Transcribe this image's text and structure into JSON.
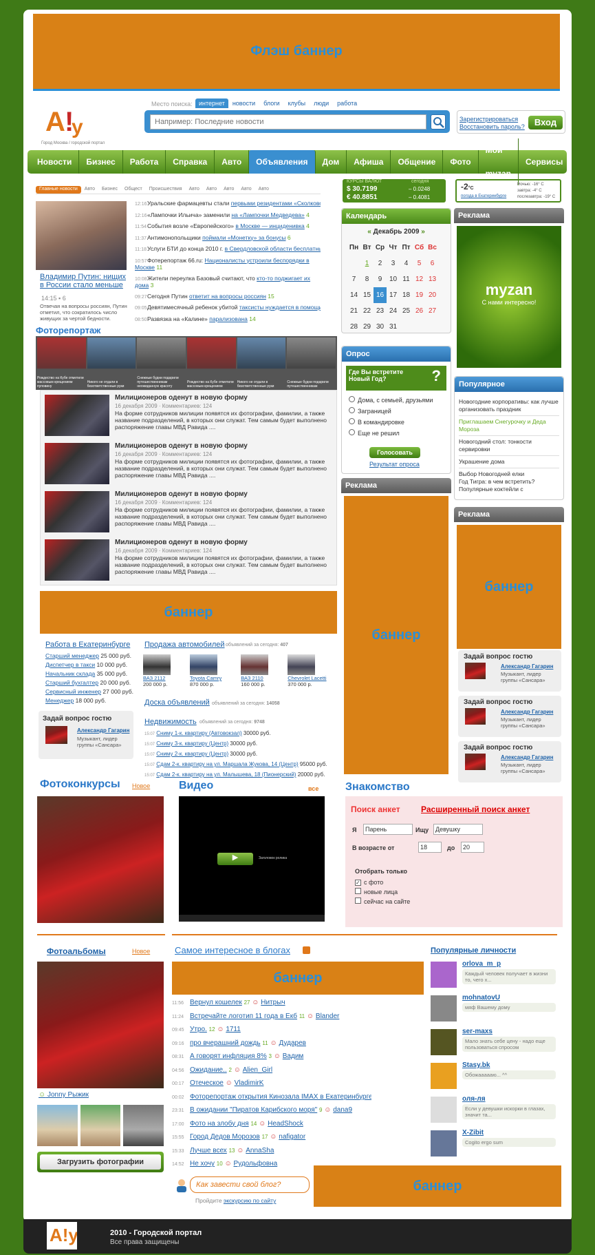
{
  "banners": {
    "flash": "Флэш баннер",
    "generic": "баннер"
  },
  "search": {
    "place_label": "Место поиска:",
    "tabs": [
      "интернет",
      "новости",
      "блоги",
      "клубы",
      "люди",
      "работа"
    ],
    "placeholder": "Например: Последние новости",
    "register": "Зарегистрироваться",
    "restore": "Восстановить пароль?",
    "login": "Вход"
  },
  "logo": {
    "caption": "Город Москва / городской портал"
  },
  "nav": [
    "Новости",
    "Бизнес",
    "Работа",
    "Справка",
    "Авто",
    "Объявления",
    "Дом",
    "Афиша",
    "Общение",
    "Фото",
    "Мой myzan",
    "Сервисы"
  ],
  "news": {
    "tabs": [
      "Главные новости",
      "Авто",
      "Бизнес",
      "Общест",
      "Происшествия",
      "Авто",
      "Авто",
      "Авто",
      "Авто",
      "Авто"
    ],
    "lead_title": "Владимир Путин: нищих в России стало меньше",
    "lead_time": "14:15",
    "lead_count": "6",
    "lead_text": "Отвечая на вопросы россиян, Путин отметил, что сократилось число живущих за чертой бедности.",
    "items": [
      {
        "time": "12:16",
        "pre": "Уральские фармацевты стали ",
        "link": "первыми резидентами «Сколково»",
        "count": "1"
      },
      {
        "time": "12:16",
        "pre": "«Лампочки Ильича» заменили ",
        "link": "на «Лампочки Медведева»",
        "count": "4"
      },
      {
        "time": "11:54",
        "pre": "События возле «Европейского» ",
        "link": "в Москве — инциденивка",
        "count": "4"
      },
      {
        "time": "11:37",
        "pre": "Антимонопольщики ",
        "link": "поймали «Монетку» за бонусы",
        "count": "6"
      },
      {
        "time": "11:18",
        "pre": "Услуги БТИ до конца 2010 г. ",
        "link": "в Свердловской области бесплатны",
        "count": "1"
      },
      {
        "time": "10:57",
        "pre": "Фотерепортаж 66.ru: ",
        "link": "Националисты устроили беспорядки в Москве",
        "count": "11"
      },
      {
        "time": "10:08",
        "pre": "Жители переулка Базовый считают, что ",
        "link": "кто-то поджигает их дома",
        "count": "3"
      },
      {
        "time": "09:27",
        "pre": "Сегодня Путин ",
        "link": "ответит на вопросы россиян",
        "count": "15"
      },
      {
        "time": "09:05",
        "pre": "Девятимесячный ребенок убитой ",
        "link": "таксисты нуждается в помощи",
        "count": "8"
      },
      {
        "time": "08:50",
        "pre": "Развязка на «Калине» ",
        "link": "парализована",
        "count": "14"
      }
    ]
  },
  "photoreport": {
    "title": "Фоторепортаж",
    "captions": [
      "Рождество на Кубе отметили массовым крещением пуповину",
      "Никого не отдали в безответственные руки",
      "Снежные будни подарили путешественникам неожиданную красоту",
      "Рождество на Кубе отметили массовым крещением",
      "Никого не отдали в безответственные руки",
      "Снежные будни подарили путешественникам"
    ]
  },
  "articles": [
    {
      "title": "Милиционеров оденут в новую форму",
      "date": "16 декабря 2009",
      "comments": "Комментариев: 124",
      "text": "На форме сотрудников милиции появятся их фотографии, фамилии, а также название подразделений, в которых они служат. Тем самым будет выполнено распоряжение главы МВД Равида ....",
      "more": "Подробнее..."
    },
    {
      "title": "Милиционеров оденут в новую форму",
      "date": "16 декабря 2009",
      "comments": "Комментариев: 124",
      "text": "На форме сотрудников милиции появятся их фотографии, фамилии, а также название подразделений, в которых они служат. Тем самым будет выполнено распоряжение главы МВД Равида ....",
      "more": "Подробнее..."
    },
    {
      "title": "Милиционеров оденут в новую форму",
      "date": "16 декабря 2009",
      "comments": "Комментариев: 124",
      "text": "На форме сотрудников милиции появятся их фотографии, фамилии, а также название подразделений, в которых они служат. Тем самым будет выполнено распоряжение главы МВД Равида ....",
      "more": "Подробнее..."
    },
    {
      "title": "Милиционеров оденут в новую форму",
      "date": "16 декабря 2009",
      "comments": "Комментариев: 124",
      "text": "На форме сотрудников милиции появятся их фотографии, фамилии, а также название подразделений, в которых они служат. Тем самым будет выполнено распоряжение главы МВД Равида ....",
      "more": "Подробнее..."
    }
  ],
  "jobs": {
    "title": "Работа в Екатеринбурге",
    "items": [
      {
        "name": "Старший менеджер",
        "price": "25 000 руб."
      },
      {
        "name": "Диспетчер в такси",
        "price": "10 000 руб."
      },
      {
        "name": "Начальник склада",
        "price": "35 000 руб."
      },
      {
        "name": "Старший бухгалтер",
        "price": "20 000 руб."
      },
      {
        "name": "Сервисный инженер",
        "price": "27 000 руб."
      },
      {
        "name": "Менеджер",
        "price": "18 000 руб."
      }
    ]
  },
  "cars": {
    "title": "Продажа автомобилей",
    "today": "объявлений за сегодня:",
    "count": "407",
    "items": [
      {
        "name": "ВАЗ 2112",
        "price": "200 000 р."
      },
      {
        "name": "Toyota Camry",
        "price": "870 000 р."
      },
      {
        "name": "ВАЗ 2110",
        "price": "160 000 р."
      },
      {
        "name": "Chevrolet Lacetti",
        "price": "370 000 р."
      }
    ]
  },
  "board": {
    "title": "Доска объявлений",
    "today": "объявлений за сегодня:",
    "count": "14058"
  },
  "realty": {
    "title": "Недвижимость",
    "today": "объявлений за сегодня:",
    "count": "9748",
    "items": [
      {
        "time": "15:07",
        "link": "Сниму 1-к. квартиру (Автовокзал)",
        "price": "30000 руб."
      },
      {
        "time": "15:07",
        "link": "Сниму 3-к. квартиру (Центр)",
        "price": "30000 руб."
      },
      {
        "time": "15:07",
        "link": "Сниму 2-к. квартиру (Центр)",
        "price": "30000 руб."
      },
      {
        "time": "15:07",
        "link": "Сдам 2-к. квартиру на ул. Маршала Жукова, 14 (Центр)",
        "price": "95000 руб."
      },
      {
        "time": "15:07",
        "link": "Сдам 2-к. квартиру на ул. Малышева, 18 (Пионерский)",
        "price": "20000 руб."
      }
    ]
  },
  "ask": {
    "title": "Задай вопрос гостю",
    "name": "Александр Гагарин",
    "desc": "Музыкант, лидер группы «Сансара»"
  },
  "currency": {
    "title": "КУРСЫ ВАЛЮТ",
    "date": "сегодня",
    "usd": "$ 30.7199",
    "usd_delta": "– 0.0248",
    "eur": "€ 40.8851",
    "eur_delta": "– 0.4081"
  },
  "weather": {
    "now": "-2",
    "now_label": "°C",
    "city": "погода в Екатеринбурге",
    "rows": [
      "Ночью: -16° C",
      "завтра: -4° C",
      "послезавтра: -19° C"
    ]
  },
  "calendar": {
    "title": "Календарь",
    "month": "Декабрь 2009",
    "days": [
      "Пн",
      "Вт",
      "Ср",
      "Чт",
      "Пт",
      "Сб",
      "Вс"
    ],
    "weeks": [
      [
        "",
        "1",
        "2",
        "3",
        "4",
        "5",
        "6"
      ],
      [
        "7",
        "8",
        "9",
        "10",
        "11",
        "12",
        "13"
      ],
      [
        "14",
        "15",
        "16",
        "17",
        "18",
        "19",
        "20"
      ],
      [
        "21",
        "22",
        "23",
        "24",
        "25",
        "26",
        "27"
      ],
      [
        "28",
        "29",
        "30",
        "31",
        "",
        "",
        ""
      ]
    ]
  },
  "poll": {
    "title": "Опрос",
    "question": "Где Вы встретите Новый Год?",
    "options": [
      "Дома, с семьей, друзьями",
      "Заграницей",
      "В командировке",
      "Еще не решил"
    ],
    "vote": "Голосовать",
    "results": "Результат опроса"
  },
  "ads": {
    "title": "Реклама",
    "myzan": "myzan",
    "slogan": "С нами интересно!"
  },
  "popular": {
    "title": "Популярное",
    "items": [
      "Новогодние корпоративы: как лучше организовать праздник",
      "Приглашаем Снегурочку и Деда Мороза",
      "Новогодний стол: тонкости сервировки",
      "Украшение дома",
      "Выбор Новогодней елки",
      "Год Тигра: в чем встретить?",
      "Популярные коктейли с"
    ]
  },
  "photocontest": {
    "title": "Фотоконкурсы",
    "new": "Новое"
  },
  "video": {
    "title": "Видео",
    "all": "все",
    "caption": "Заголовок ролика"
  },
  "dating": {
    "title": "Знакомство",
    "search": "Поиск анкет",
    "ext": "Расширенный поиск анкет",
    "i_label": "Я",
    "i_value": "Парень",
    "seek_label": "Ищу",
    "seek_value": "Девушку",
    "age_label": "В возрасте от",
    "age_from": "18",
    "age_to_label": "до",
    "age_to": "20",
    "show": "Отобрать только",
    "checks": [
      "с фото",
      "новые лица",
      "сейчас на сайте"
    ]
  },
  "albums": {
    "title": "Фотоальбомы",
    "new": "Новое",
    "author": "Jonny Рыжик",
    "upload": "Загрузить фотографии"
  },
  "blogs": {
    "title": "Самое интересное в блогах",
    "rows": [
      {
        "time": "11:56",
        "link": "Вернул кошелек",
        "c1": "27",
        "user": "Нитрыч"
      },
      {
        "time": "11:24",
        "link": "Встречайте логотип 11 года в Екб",
        "c1": "11",
        "user": "Blander"
      },
      {
        "time": "09:45",
        "link": "Утро.",
        "c1": "12",
        "user": "1711"
      },
      {
        "time": "09:16",
        "link": "про вчерашний дождь",
        "c1": "11",
        "user": "Дударев"
      },
      {
        "time": "08:31",
        "link": "А говорят инфляция 8%",
        "c1": "3",
        "user": "Вадим"
      },
      {
        "time": "04:56",
        "link": "Ожидание..",
        "c1": "2",
        "user": "Alien_Girl"
      },
      {
        "time": "00:17",
        "link": "Отеческое",
        "c1": "",
        "user": "VladimirK"
      },
      {
        "time": "00:02",
        "link": "Фоторепортаж открытия Кинозала IMAX в Екатеринбурге.",
        "c1": "3",
        "user": "sokhovich"
      },
      {
        "time": "23:31",
        "link": "В ожидании \"Пиратов Карибского моря\"",
        "c1": "9",
        "user": "dana9"
      },
      {
        "time": "17:00",
        "link": "Фото на злобу дня",
        "c1": "14",
        "user": "HeadShock"
      },
      {
        "time": "15:55",
        "link": "Город Дедов Морозов",
        "c1": "17",
        "user": "nafigator"
      },
      {
        "time": "15:33",
        "link": "Лучше всех",
        "c1": "13",
        "user": "AnnaSha"
      },
      {
        "time": "14:52",
        "link": "Не хочу",
        "c1": "10",
        "user": "Рудольфовна"
      }
    ],
    "how": "Как завести свой блог?",
    "tour_pre": "Пройдите ",
    "tour": "экскурсию по сайту"
  },
  "persons": {
    "title": "Популярные личности",
    "items": [
      {
        "name": "orlova_m_p",
        "quote": "Каждый человек получает в жизни то, чего х..."
      },
      {
        "name": "mohnatovU",
        "quote": "мяф Вашему дому"
      },
      {
        "name": "ser-maxs",
        "quote": "Мало знать себе цену - надо еще пользоваться спросом"
      },
      {
        "name": "Stasy.bk",
        "quote": "Обожаааааю... ^^"
      },
      {
        "name": "оля-ля",
        "quote": "Если у девушки искорки в глазах, значит та..."
      },
      {
        "name": "X-Zibit",
        "quote": "Cogito ergo sum"
      }
    ]
  },
  "footer": {
    "year": "2010 - Городской портал",
    "rights": "Все права защищены"
  }
}
